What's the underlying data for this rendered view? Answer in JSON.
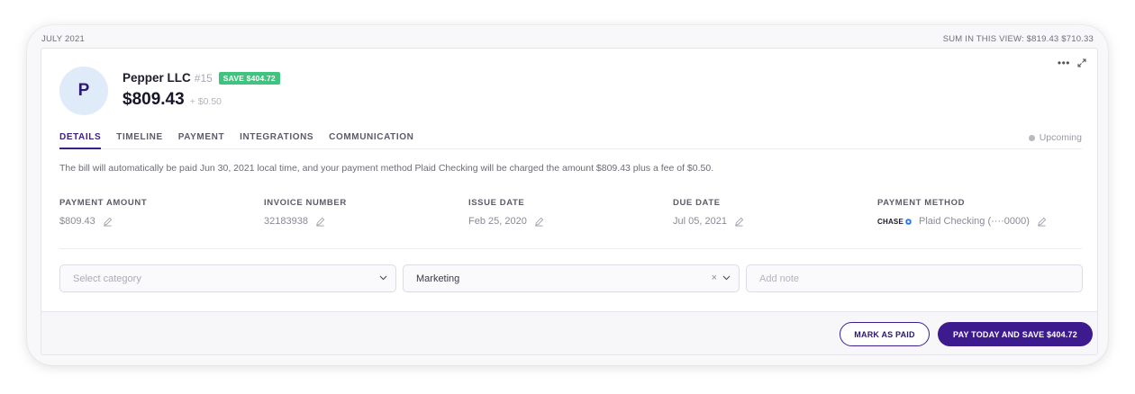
{
  "header": {
    "month": "JULY 2021",
    "sum_label": "SUM IN THIS VIEW: $819.43 $710.33"
  },
  "bill": {
    "avatar_letter": "P",
    "vendor_name": "Pepper LLC",
    "vendor_number": "#15",
    "save_badge": "SAVE $404.72",
    "amount": "$809.43",
    "fee": "+ $0.50",
    "more_icon": "more-dots-icon",
    "expand_icon": "expand-icon"
  },
  "tabs": [
    {
      "label": "DETAILS",
      "active": true
    },
    {
      "label": "TIMELINE",
      "active": false
    },
    {
      "label": "PAYMENT",
      "active": false
    },
    {
      "label": "INTEGRATIONS",
      "active": false
    },
    {
      "label": "COMMUNICATION",
      "active": false
    }
  ],
  "status": "Upcoming",
  "info_text": "The bill will automatically be paid Jun 30, 2021 local time, and your payment method Plaid Checking will be charged the amount $809.43 plus a fee of $0.50.",
  "fields": {
    "payment_amount": {
      "label": "PAYMENT AMOUNT",
      "value": "$809.43"
    },
    "invoice_number": {
      "label": "INVOICE NUMBER",
      "value": "32183938"
    },
    "issue_date": {
      "label": "ISSUE DATE",
      "value": "Feb 25, 2020"
    },
    "due_date": {
      "label": "DUE DATE",
      "value": "Jul 05, 2021"
    },
    "payment_method": {
      "label": "PAYMENT METHOD",
      "bank_logo": "CHASE",
      "value": "Plaid Checking (····0000)"
    }
  },
  "inputs": {
    "category_placeholder": "Select category",
    "category2_value": "Marketing",
    "clear_glyph": "×",
    "note_placeholder": "Add note"
  },
  "footer": {
    "mark_paid_label": "MARK AS PAID",
    "pay_label": "PAY TODAY AND SAVE $404.72"
  },
  "colors": {
    "brand": "#3a1f8f",
    "save_green": "#3ec47f",
    "avatar_bg": "#e0ebf9"
  }
}
